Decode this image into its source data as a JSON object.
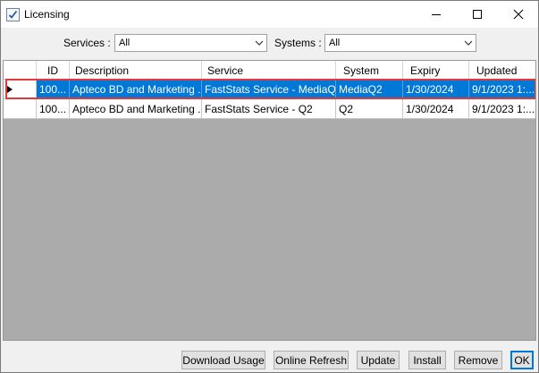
{
  "window": {
    "title": "Licensing"
  },
  "filters": {
    "services_label": "Services :",
    "services_value": "All",
    "systems_label": "Systems :",
    "systems_value": "All"
  },
  "grid": {
    "columns": [
      "ID",
      "Description",
      "Service",
      "System",
      "Expiry",
      "Updated"
    ],
    "rows": [
      {
        "id": "100...",
        "description": "Apteco BD and Marketing ...",
        "service": "FastStats Service - MediaQ2",
        "system": "MediaQ2",
        "expiry": "1/30/2024",
        "updated": "9/1/2023 1:...",
        "selected": true
      },
      {
        "id": "100...",
        "description": "Apteco BD and Marketing ...",
        "service": "FastStats Service - Q2",
        "system": "Q2",
        "expiry": "1/30/2024",
        "updated": "9/1/2023 1:...",
        "selected": false
      }
    ]
  },
  "buttons": {
    "download_usage": "Download Usage",
    "online_refresh": "Online Refresh",
    "update": "Update",
    "install": "Install",
    "remove": "Remove",
    "ok": "OK"
  },
  "colors": {
    "selection": "#0078d7",
    "highlight_outline": "#e23a3a",
    "grid_background": "#ababab"
  }
}
